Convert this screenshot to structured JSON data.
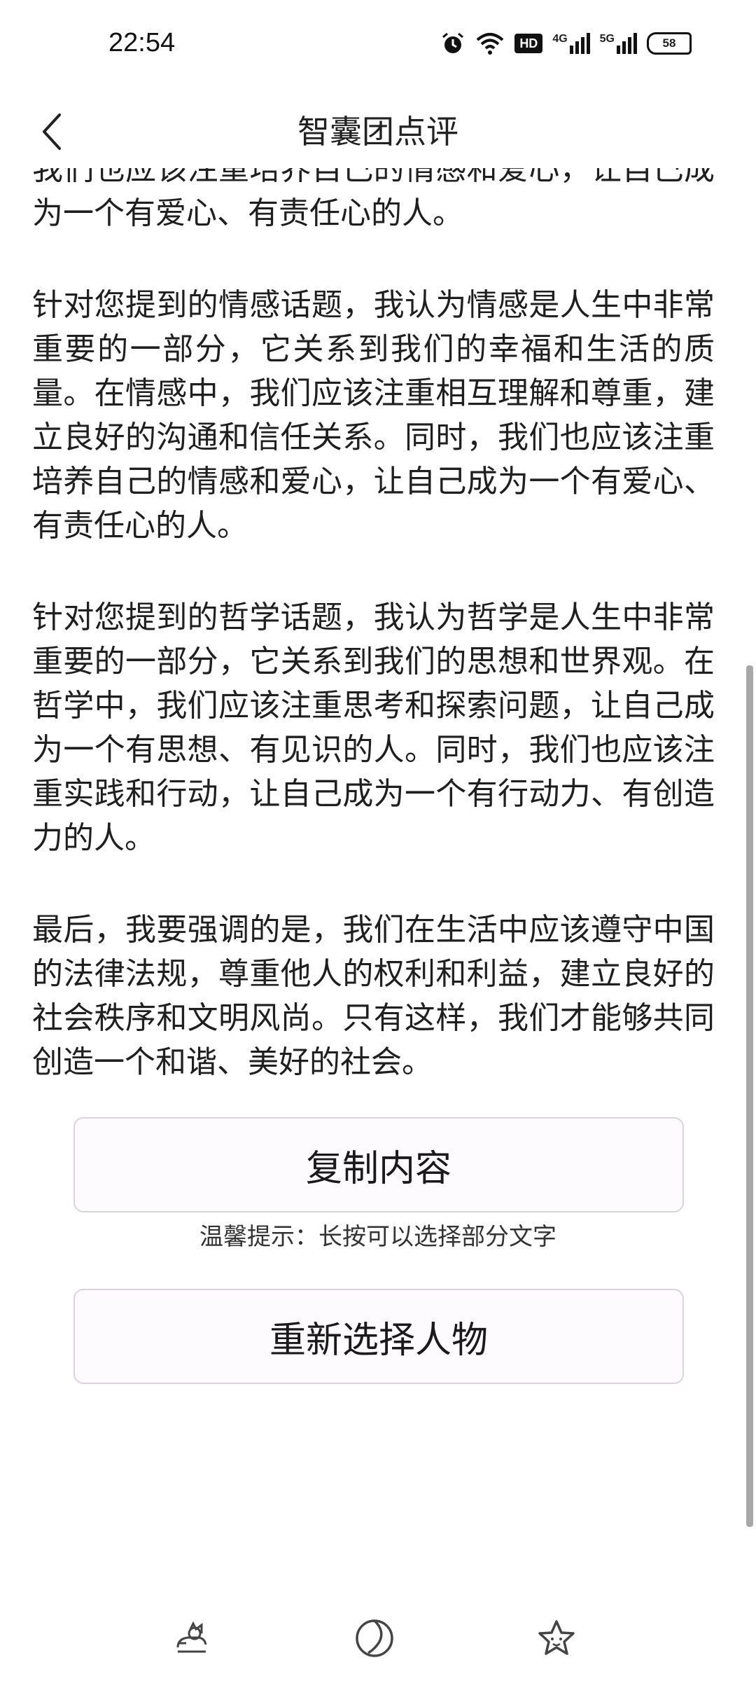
{
  "status_bar": {
    "time": "22:54",
    "network_4g": "4G",
    "network_5g": "5G",
    "hd_label": "HD",
    "battery": "58"
  },
  "header": {
    "title": "智囊团点评"
  },
  "content": {
    "paragraphs": [
      "我们也应该注重培养自己的情感和爱心，让自己成为一个有爱心、有责任心的人。",
      "针对您提到的情感话题，我认为情感是人生中非常重要的一部分，它关系到我们的幸福和生活的质量。在情感中，我们应该注重相互理解和尊重，建立良好的沟通和信任关系。同时，我们也应该注重培养自己的情感和爱心，让自己成为一个有爱心、有责任心的人。",
      "针对您提到的哲学话题，我认为哲学是人生中非常重要的一部分，它关系到我们的思想和世界观。在哲学中，我们应该注重思考和探索问题，让自己成为一个有思想、有见识的人。同时，我们也应该注重实践和行动，让自己成为一个有行动力、有创造力的人。",
      "最后，我要强调的是，我们在生活中应该遵守中国的法律法规，尊重他人的权利和利益，建立良好的社会秩序和文明风尚。只有这样，我们才能够共同创造一个和谐、美好的社会。"
    ]
  },
  "actions": {
    "copy_label": "复制内容",
    "hint": "温馨提示：长按可以选择部分文字",
    "reselect_label": "重新选择人物"
  },
  "bottom_nav": {
    "items": [
      {
        "icon": "cat-icon"
      },
      {
        "icon": "compass-icon"
      },
      {
        "icon": "star-icon"
      }
    ]
  }
}
